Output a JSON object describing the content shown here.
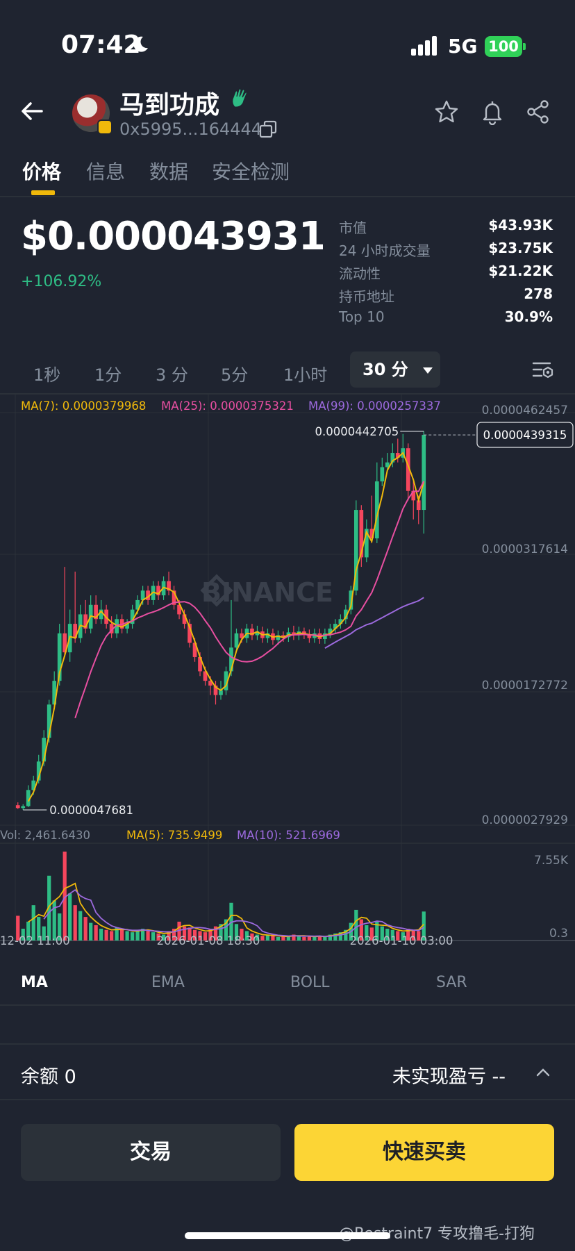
{
  "status_bar": {
    "time": "07:42",
    "network": "5G",
    "battery": "100"
  },
  "header": {
    "token_name": "马到功成",
    "address": "0x5995...164444"
  },
  "tabs": [
    {
      "label": "价格",
      "active": true
    },
    {
      "label": "信息",
      "active": false
    },
    {
      "label": "数据",
      "active": false
    },
    {
      "label": "安全检测",
      "active": false
    }
  ],
  "price": {
    "value": "$0.000043931",
    "change": "+106.92%"
  },
  "stats": [
    {
      "label": "市值",
      "value": "$43.93K"
    },
    {
      "label": "24 小时成交量",
      "value": "$23.75K"
    },
    {
      "label": "流动性",
      "value": "$21.22K"
    },
    {
      "label": "持币地址",
      "value": "278"
    },
    {
      "label": "Top 10",
      "value": "30.9%"
    }
  ],
  "intervals": [
    "1秒",
    "1分",
    "3 分",
    "5分",
    "1小时"
  ],
  "interval_active": "30 分",
  "chart_data": {
    "type": "candlestick",
    "ma_legend": [
      {
        "label": "MA(7): 0.0000379968",
        "color": "#f0b90b"
      },
      {
        "label": "MA(25): 0.0000375321",
        "color": "#e84fa1"
      },
      {
        "label": "MA(99): 0.0000257337",
        "color": "#9c6ade"
      }
    ],
    "y_ticks": [
      "0.0000462457",
      "0.0000317614",
      "0.0000172772",
      "0.0000027929"
    ],
    "ylim": [
      2.7929e-06,
      4.62457e-05
    ],
    "current_price_label": "0.0000439315",
    "high_label": "0.0000442705",
    "low_label": "0.0000047681",
    "watermark": "BINANCE",
    "volume_legend": [
      {
        "label": "Vol: 2,461.6430",
        "color": "#848e9c"
      },
      {
        "label": "MA(5): 735.9499",
        "color": "#f0b90b"
      },
      {
        "label": "MA(10): 521.6969",
        "color": "#9c6ade"
      }
    ],
    "volume_ticks": [
      "7.55K",
      "0.3"
    ],
    "x_ticks": [
      "12-02 11:00",
      "2026-01-08 18:30",
      "2026-01-10 03:00"
    ],
    "candles": [
      [
        4.9,
        4.6,
        5.2,
        4.5
      ],
      [
        4.6,
        4.8,
        5.0,
        4.4
      ],
      [
        4.8,
        6.5,
        7.0,
        4.7
      ],
      [
        6.5,
        7.5,
        8.0,
        6.0
      ],
      [
        7.5,
        9.5,
        10.2,
        7.2
      ],
      [
        9.5,
        12.0,
        12.8,
        9.0
      ],
      [
        12.0,
        15.5,
        16.0,
        11.5
      ],
      [
        15.5,
        18.0,
        19.0,
        15.0
      ],
      [
        18.0,
        23.0,
        24.0,
        17.5
      ],
      [
        23.0,
        21.0,
        30.0,
        20.5
      ],
      [
        21.0,
        24.0,
        25.5,
        20.0
      ],
      [
        24.0,
        22.5,
        29.5,
        22.0
      ],
      [
        22.5,
        25.0,
        26.0,
        22.0
      ],
      [
        25.0,
        23.5,
        26.5,
        23.0
      ],
      [
        23.5,
        26.0,
        27.0,
        23.0
      ],
      [
        26.0,
        24.5,
        27.0,
        24.0
      ],
      [
        24.5,
        25.5,
        26.5,
        24.0
      ],
      [
        25.5,
        24.0,
        26.0,
        23.5
      ],
      [
        24.0,
        23.0,
        24.8,
        22.5
      ],
      [
        23.0,
        24.5,
        25.0,
        22.5
      ],
      [
        24.5,
        23.5,
        25.0,
        23.0
      ],
      [
        23.5,
        24.0,
        24.5,
        23.0
      ],
      [
        24.0,
        25.5,
        26.0,
        23.5
      ],
      [
        25.5,
        26.5,
        27.0,
        25.0
      ],
      [
        26.5,
        27.5,
        28.0,
        26.0
      ],
      [
        27.5,
        26.5,
        28.0,
        26.0
      ],
      [
        26.5,
        28.0,
        28.5,
        26.0
      ],
      [
        28.0,
        27.0,
        28.5,
        26.5
      ],
      [
        27.0,
        28.5,
        29.0,
        26.5
      ],
      [
        28.5,
        27.5,
        29.5,
        27.0
      ],
      [
        27.5,
        26.0,
        28.0,
        25.5
      ],
      [
        26.0,
        25.0,
        26.5,
        24.5
      ],
      [
        25.0,
        24.0,
        25.5,
        23.5
      ],
      [
        24.0,
        22.0,
        24.5,
        21.5
      ],
      [
        22.0,
        20.5,
        22.5,
        20.0
      ],
      [
        20.5,
        19.0,
        21.0,
        18.5
      ],
      [
        19.0,
        18.0,
        19.5,
        17.5
      ],
      [
        18.0,
        17.5,
        18.5,
        16.5
      ],
      [
        17.5,
        16.5,
        18.0,
        15.5
      ],
      [
        16.5,
        17.0,
        18.0,
        16.0
      ],
      [
        17.0,
        19.0,
        19.5,
        16.5
      ],
      [
        19.0,
        21.5,
        26.5,
        18.5
      ],
      [
        21.5,
        23.0,
        23.5,
        21.0
      ],
      [
        23.0,
        22.5,
        23.5,
        22.0
      ],
      [
        22.5,
        23.5,
        24.0,
        22.0
      ],
      [
        23.5,
        22.8,
        24.0,
        22.3
      ],
      [
        22.8,
        23.2,
        23.8,
        22.3
      ],
      [
        23.2,
        22.5,
        23.7,
        22.0
      ],
      [
        22.5,
        23.0,
        23.5,
        22.0
      ],
      [
        23.0,
        22.3,
        23.5,
        21.8
      ],
      [
        22.3,
        22.8,
        23.3,
        21.8
      ],
      [
        22.8,
        22.6,
        23.2,
        22.1
      ],
      [
        22.6,
        23.1,
        23.6,
        22.1
      ],
      [
        23.1,
        22.8,
        23.8,
        22.3
      ],
      [
        22.8,
        23.2,
        23.7,
        22.3
      ],
      [
        23.2,
        22.9,
        23.6,
        22.4
      ],
      [
        22.9,
        22.5,
        23.4,
        22.0
      ],
      [
        22.5,
        23.0,
        23.5,
        22.0
      ],
      [
        23.0,
        22.4,
        23.5,
        21.9
      ],
      [
        22.4,
        23.0,
        23.5,
        21.9
      ],
      [
        23.0,
        23.5,
        24.0,
        22.5
      ],
      [
        23.5,
        24.0,
        24.5,
        23.0
      ],
      [
        24.0,
        24.5,
        25.0,
        23.5
      ],
      [
        24.5,
        25.5,
        26.0,
        24.0
      ],
      [
        25.5,
        27.5,
        28.0,
        25.0
      ],
      [
        27.5,
        36.0,
        37.0,
        27.0
      ],
      [
        36.0,
        31.0,
        36.5,
        30.0
      ],
      [
        31.0,
        34.0,
        35.0,
        30.5
      ],
      [
        34.0,
        33.0,
        37.5,
        32.5
      ],
      [
        33.0,
        39.0,
        41.0,
        32.5
      ],
      [
        39.0,
        40.5,
        41.5,
        38.5
      ],
      [
        40.5,
        41.0,
        42.0,
        40.0
      ],
      [
        41.0,
        42.0,
        43.0,
        40.5
      ],
      [
        42.0,
        41.5,
        43.5,
        41.0
      ],
      [
        41.5,
        42.5,
        44.0,
        41.0
      ],
      [
        42.5,
        38.0,
        43.0,
        37.0
      ],
      [
        38.0,
        37.0,
        39.0,
        35.0
      ],
      [
        37.0,
        36.0,
        37.5,
        34.5
      ],
      [
        36.0,
        43.9,
        44.27,
        33.5
      ]
    ],
    "volumes": [
      2.1,
      1.0,
      1.6,
      3.0,
      2.0,
      1.2,
      5.5,
      3.4,
      2.3,
      7.55,
      4.0,
      3.0,
      2.5,
      2.0,
      1.5,
      1.3,
      1.0,
      0.9,
      0.8,
      1.1,
      0.9,
      0.8,
      0.7,
      0.9,
      1.0,
      0.8,
      0.7,
      0.6,
      0.5,
      0.8,
      1.0,
      1.6,
      1.2,
      1.1,
      0.9,
      0.8,
      0.7,
      1.0,
      1.2,
      1.4,
      1.8,
      3.2,
      1.4,
      1.0,
      0.8,
      0.6,
      0.5,
      0.4,
      0.5,
      0.4,
      0.3,
      0.4,
      0.3,
      0.5,
      0.4,
      0.3,
      0.4,
      0.3,
      0.4,
      0.3,
      0.5,
      0.6,
      0.7,
      0.9,
      1.5,
      2.6,
      1.8,
      1.3,
      1.1,
      1.6,
      1.2,
      1.0,
      0.9,
      0.8,
      0.7,
      1.0,
      0.9,
      0.8,
      2.46
    ]
  },
  "indicator_tabs": [
    {
      "label": "MA",
      "active": true
    },
    {
      "label": "EMA",
      "active": false
    },
    {
      "label": "BOLL",
      "active": false
    },
    {
      "label": "SAR",
      "active": false
    }
  ],
  "bottom": {
    "balance": "余额 0",
    "pnl": "未实现盈亏 --",
    "trade_button": "交易",
    "quick_button": "快速买卖",
    "watermark": "@Restraint7 专攻撸毛-打狗"
  },
  "colors": {
    "up": "#2ebd85",
    "down": "#f6465d",
    "accent": "#f0b90b",
    "button_yellow": "#fcd535"
  }
}
